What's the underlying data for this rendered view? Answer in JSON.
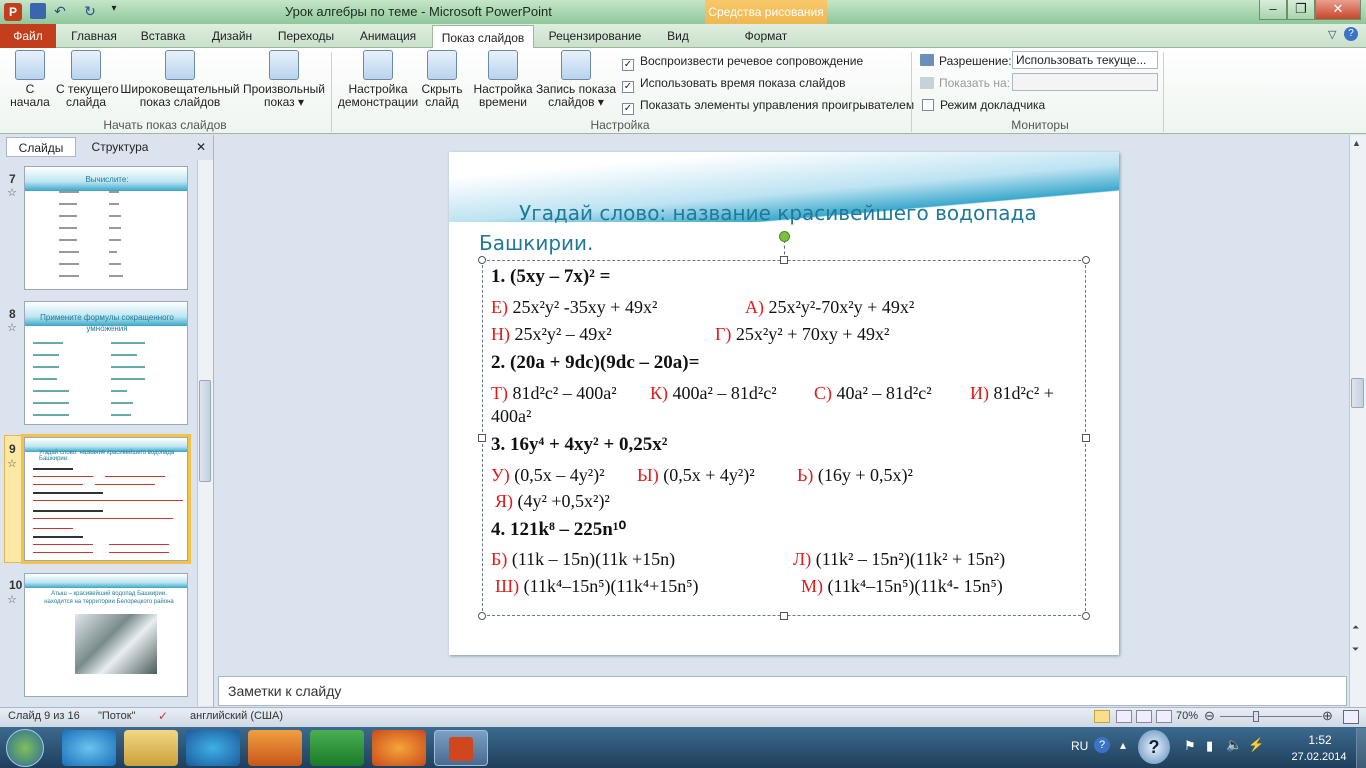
{
  "window": {
    "title": "Урок алгебры по теме  -  Microsoft PowerPoint",
    "context_tab": "Средства рисования",
    "buttons": [
      "–",
      "❐",
      "✕"
    ]
  },
  "tabs": [
    "Файл",
    "Главная",
    "Вставка",
    "Дизайн",
    "Переходы",
    "Анимация",
    "Показ слайдов",
    "Рецензирование",
    "Вид",
    "Формат"
  ],
  "ribbon": {
    "start": {
      "from_start": "С\nначала",
      "from_current": "С текущего\nслайда",
      "broadcast": "Широковещательный\nпоказ слайдов",
      "custom": "Произвольный\nпоказ ▾",
      "group_label": "Начать показ слайдов"
    },
    "setup": {
      "setup_show": "Настройка\nдемонстрации",
      "hide_slide": "Скрыть\nслайд",
      "rehearse": "Настройка\nвремени",
      "record": "Запись показа\nслайдов ▾",
      "cb_narrations": "Воспроизвести речевое сопровождение",
      "cb_timings": "Использовать время показа слайдов",
      "cb_controls": "Показать элементы управления проигрывателем",
      "group_label": "Настройка"
    },
    "monitors": {
      "resolution_label": "Разрешение:",
      "resolution_value": "Использовать текуще...",
      "show_on_label": "Показать на:",
      "presenter_view": "Режим докладчика",
      "group_label": "Мониторы"
    }
  },
  "left_pane": {
    "tab_slides": "Слайды",
    "tab_outline": "Структура",
    "close": "✕",
    "slides": [
      {
        "num": "7",
        "title": "Вычислите:"
      },
      {
        "num": "8",
        "title": "Примените формулы сокращенного умножения"
      },
      {
        "num": "9",
        "title": "Угадай слово: название красивейшего водопада Башкирии."
      },
      {
        "num": "10",
        "title": "Атыш – красивейший водопад Башкирии, находится на территории Белорецкого района"
      }
    ]
  },
  "slide": {
    "title": "Угадай слово: название красивейшего водопада Башкирии.",
    "q1": "1. (5xy – 7x)² =",
    "q1_a": [
      "Е)",
      "25x²y² -35xy + 49x²",
      "А)",
      "25x²y²-70x²y + 49x²"
    ],
    "q1_b": [
      "Н)",
      "25x²y² – 49x²",
      "Г)",
      "25x²y² + 70xy + 49x²"
    ],
    "q2": "2. (20a + 9dc)(9dc – 20a)=",
    "q2_a": [
      "Т)",
      "81d²c² – 400a²",
      "К)",
      "400a² – 81d²c²",
      "С)",
      "40a² – 81d²c²",
      "И)",
      "81d²c² +"
    ],
    "q2_b": "400a²",
    "q3": "3. 16y⁴ + 4xy² + 0,25x²",
    "q3_a": [
      "У)",
      "(0,5x – 4y²)²",
      "Ы)",
      "(0,5x + 4y²)²",
      "Ь)",
      "(16y + 0,5x)²"
    ],
    "q3_b": [
      "Я)",
      "(4y² +0,5x²)²"
    ],
    "q4": "4. 121k⁸ – 225n¹⁰",
    "q4_a": [
      "Б)",
      "(11k – 15n)(11k +15n)",
      "Л)",
      "(11k² – 15n²)(11k² + 15n²)"
    ],
    "q4_b": [
      "Ш)",
      "(11k⁴–15n⁵)(11k⁴+15n⁵)",
      "М)",
      "(11k⁴–15n⁵)(11k⁴- 15n⁵)"
    ]
  },
  "notes_placeholder": "Заметки к слайду",
  "status": {
    "slide_of": "Слайд 9 из 16",
    "theme": "\"Поток\"",
    "language": "английский (США)",
    "zoom": "70%"
  },
  "taskbar": {
    "lang": "RU",
    "time": "1:52",
    "date": "27.02.2014"
  }
}
